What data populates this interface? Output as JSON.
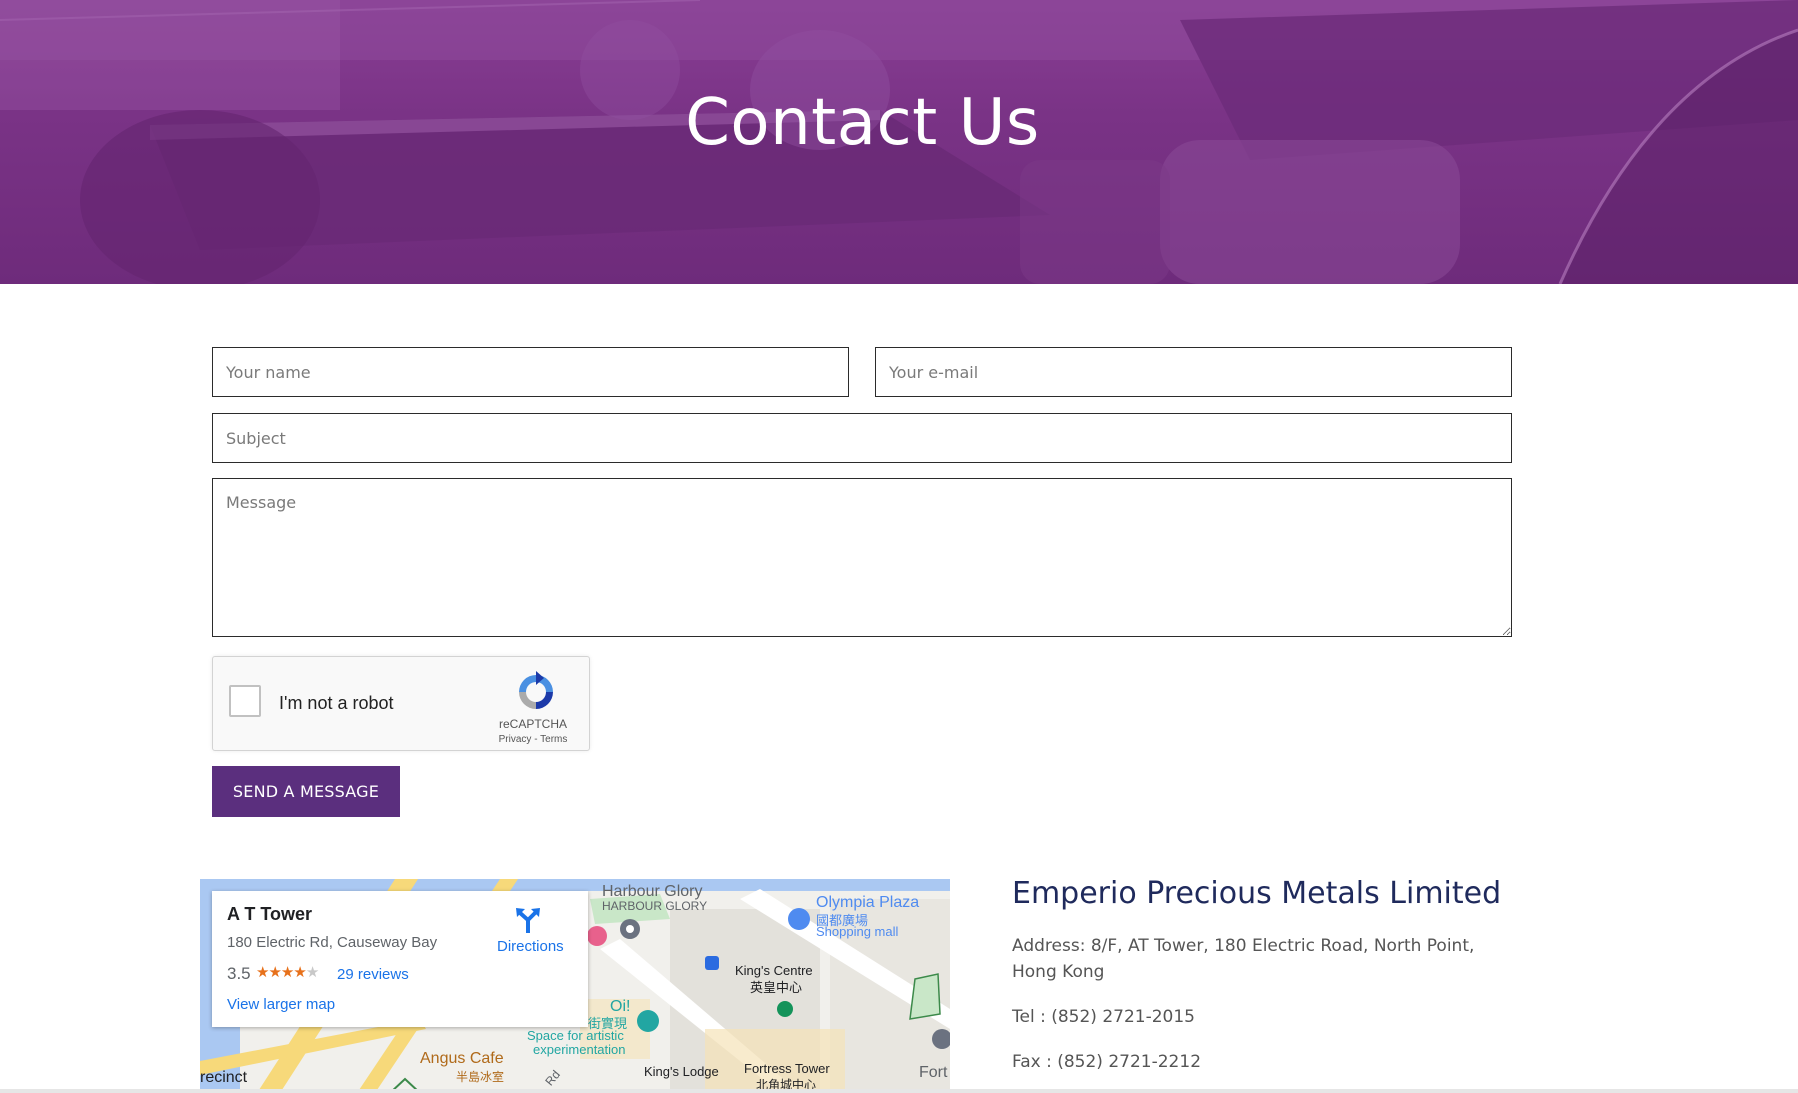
{
  "hero": {
    "title": "Contact Us"
  },
  "form": {
    "name_placeholder": "Your name",
    "email_placeholder": "Your e-mail",
    "subject_placeholder": "Subject",
    "message_placeholder": "Message",
    "send_label": "SEND A MESSAGE"
  },
  "recaptcha": {
    "label": "I'm not a robot",
    "brand": "reCAPTCHA",
    "links": "Privacy - Terms"
  },
  "map": {
    "place_name": "A T Tower",
    "address": "180 Electric Rd, Causeway Bay",
    "rating": "3.5",
    "stars": 3.5,
    "reviews": "29 reviews",
    "directions": "Directions",
    "view_larger": "View larger map",
    "labels": {
      "harbour_glory": "Harbour Glory",
      "harbour_glory_caps": "HARBOUR GLORY",
      "olympia_plaza": "Olympia Plaza",
      "olympia_cn": "國都廣場",
      "shopping_mall": "Shopping mall",
      "kings_centre": "King's Centre",
      "kings_centre_cn": "英皇中心",
      "oi": "Oi!",
      "oi_cn": "街實現",
      "space_artistic": "Space for artistic",
      "experimentation": "experimentation",
      "angus_cafe": "Angus Cafe",
      "angus_cafe_cn": "半島冰室",
      "precinct": "recinct",
      "kings_lodge": "King's Lodge",
      "fortress_tower": "Fortress Tower",
      "fortress_cn": "北角城中心",
      "fort": "Fort",
      "rd": "Rd"
    }
  },
  "company": {
    "name": "Emperio Precious Metals Limited",
    "address": "Address: 8/F, AT Tower, 180 Electric Road, North Point, Hong Kong",
    "tel": "Tel : (852) 2721-2015",
    "fax": "Fax : (852) 2721-2212"
  },
  "colors": {
    "hero_purple": "#7a3386",
    "button_purple": "#5b2f7e",
    "company_title": "#1f2a5c",
    "link_blue": "#1a73e8",
    "star_orange": "#e7711b"
  }
}
